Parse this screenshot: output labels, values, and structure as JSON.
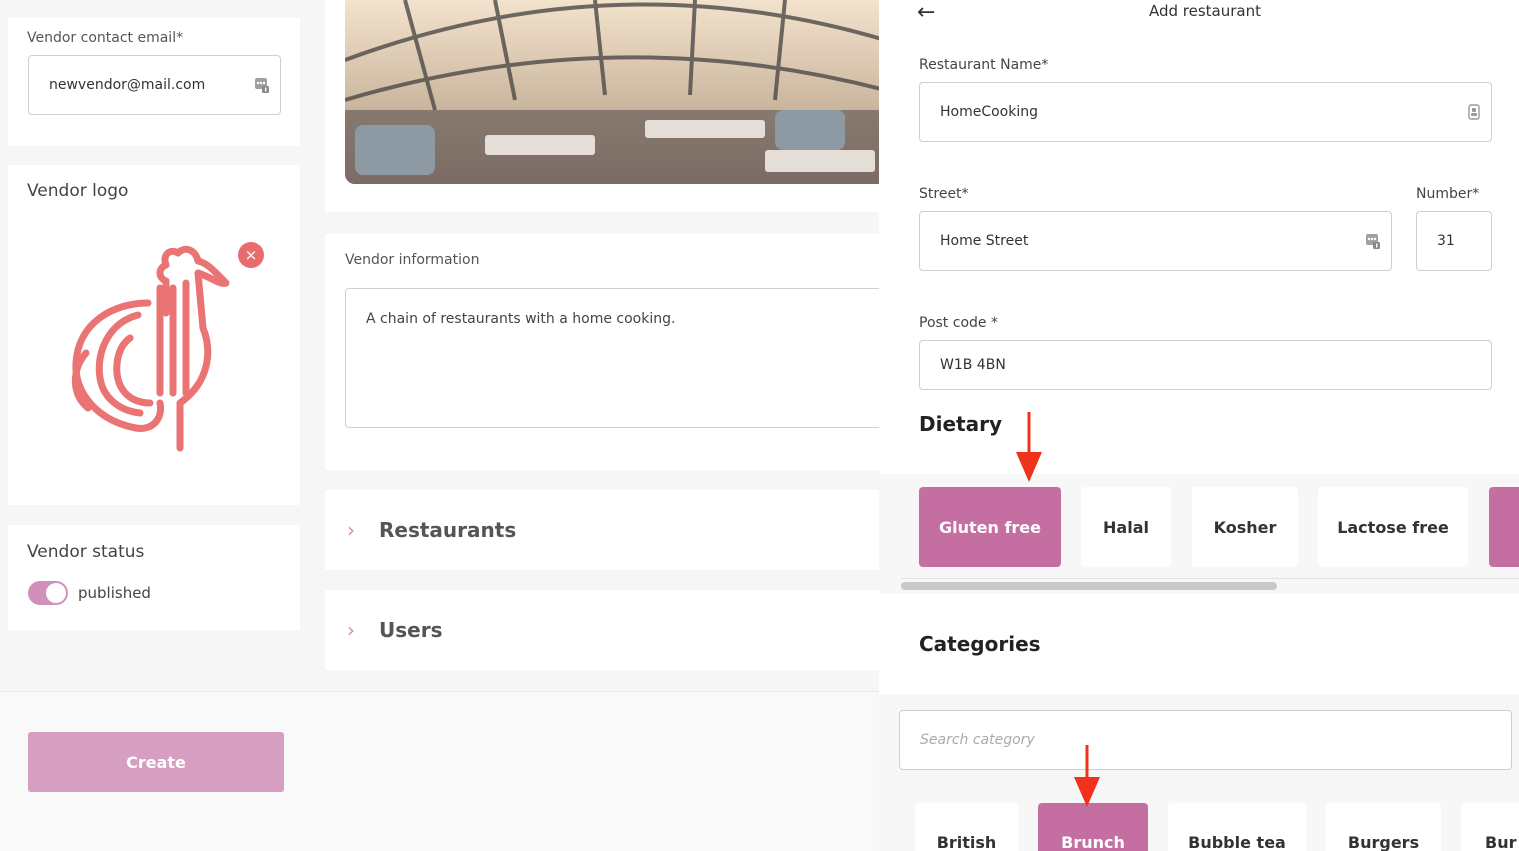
{
  "vendor_form": {
    "email_label": "Vendor contact email*",
    "email_value": "newvendor@mail.com",
    "logo_title": "Vendor logo",
    "logo_remove": "×",
    "status_title": "Vendor status",
    "status_value": "published",
    "info_label": "Vendor information",
    "info_value": "A chain of restaurants with a home cooking.",
    "create_label": "Create"
  },
  "sections": [
    {
      "chevron": "›",
      "title": "Restaurants"
    },
    {
      "chevron": "›",
      "title": "Users"
    }
  ],
  "drawer": {
    "back_icon": "←",
    "title": "Add restaurant",
    "name_label": "Restaurant Name*",
    "name_value": "HomeCooking",
    "street_label": "Street*",
    "street_value": "Home Street",
    "number_label": "Number*",
    "number_value": "31",
    "postcode_label": "Post code *",
    "postcode_value": "W1B 4BN",
    "dietary_title": "Dietary",
    "dietary": [
      {
        "label": "Gluten free",
        "selected": true
      },
      {
        "label": "Halal",
        "selected": false
      },
      {
        "label": "Kosher",
        "selected": false
      },
      {
        "label": "Lactose free",
        "selected": false
      }
    ],
    "categories_title": "Categories",
    "category_search_placeholder": "Search category",
    "categories": [
      {
        "label": "British",
        "selected": false
      },
      {
        "label": "Brunch",
        "selected": true
      },
      {
        "label": "Bubble tea",
        "selected": false
      },
      {
        "label": "Burgers",
        "selected": false
      },
      {
        "label": "Bur",
        "selected": false
      }
    ]
  },
  "colors": {
    "accent": "#c56ea2",
    "accent_light": "#d69fc2",
    "logo_red": "#e86c6e",
    "annotation_arrow": "#f0311c"
  }
}
